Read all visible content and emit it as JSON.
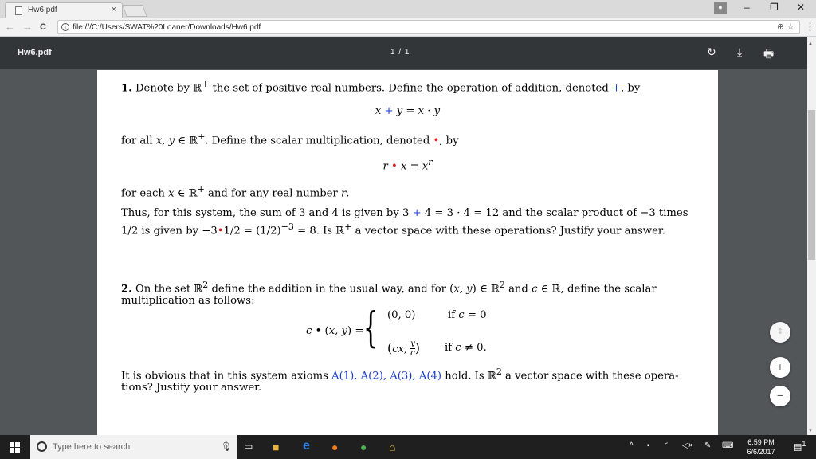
{
  "browser": {
    "tab_title": "Hw6.pdf",
    "tab_close": "×",
    "win_minimize": "–",
    "win_restore": "❐",
    "win_close": "✕",
    "url": "file:///C:/Users/SWAT%20Loaner/Downloads/Hw6.pdf",
    "back": "←",
    "forward": "→",
    "reload": "C",
    "zoom_icon": "⊕",
    "star_icon": "☆",
    "menu": "⋮"
  },
  "pdf_viewer": {
    "title": "Hw6.pdf",
    "page_indicator": "1 / 1",
    "rotate_icon": "↻",
    "download_icon": "⤓",
    "print_icon": "🖶"
  },
  "problem1": {
    "line1_a": "1.",
    "line1_b": " Denote by ℝ",
    "line1_sup": "+",
    "line1_c": " the set of positive real numbers. Define the operation of addition, denoted ",
    "plus": "+",
    "line1_d": ", by",
    "eq1_a": "x ",
    "eq1_b": " y = x · y",
    "line2_a": "for all ",
    "line2_b": "x, y",
    "line2_c": " ∈ ℝ",
    "line2_sup": "+",
    "line2_d": ". Define the scalar multiplication, denoted ",
    "dot": "•",
    "line2_e": ", by",
    "eq2_a": "r ",
    "eq2_b": " x = x",
    "eq2_sup": "r",
    "line3_a": "for each ",
    "line3_b": "x",
    "line3_c": " ∈ ℝ",
    "line3_sup": "+",
    "line3_d": " and for any real number ",
    "line3_e": "r",
    "line3_f": ".",
    "line4_a": "Thus, for this system, the sum of 3 and 4 is given by 3 ",
    "line4_b": " 4 = 3 · 4 = 12 and the scalar product of −3 times",
    "line5_a": "1/2 is given by −3",
    "line5_b": "1/2 = (1/2)",
    "line5_sup": "−3",
    "line5_c": " = 8. Is ℝ",
    "line5_sup2": "+",
    "line5_d": " a vector space with these operations? Justify your answer."
  },
  "problem2": {
    "line1_a": "2.",
    "line1_b": " On the set ℝ",
    "line1_sup": "2",
    "line1_c": " define the addition in the usual way, and for (",
    "line1_d": "x, y",
    "line1_e": ") ∈ ℝ",
    "line1_sup2": "2",
    "line1_f": " and ",
    "line1_g": "c",
    "line1_h": " ∈ ℝ, define the scalar",
    "line2": "multiplication as follows:",
    "lhs_a": "c ",
    "lhs_b": "• (",
    "lhs_c": "x, y",
    "lhs_d": ") =",
    "brace": "{",
    "case1_val": "(0, 0)",
    "case1_cond_a": "if ",
    "case1_cond_b": "c",
    "case1_cond_c": " = 0",
    "case2_val_a": "(",
    "case2_val_b": "cx, ",
    "case2_num": "y",
    "case2_den": "c",
    "case2_val_c": ")",
    "case2_cond_a": "if ",
    "case2_cond_b": "c",
    "case2_cond_c": " ≠ 0.",
    "line3_a": "It is obvious that in this system axioms ",
    "axioms": "A(1), A(2), A(3), A(4)",
    "line3_b": " hold. Is ℝ",
    "line3_sup": "2",
    "line3_c": " a vector space with these opera-",
    "line4": "tions? Justify your answer."
  },
  "zoom_controls": {
    "fit": "⇕",
    "plus": "+",
    "minus": "−"
  },
  "taskbar": {
    "search_placeholder": "Type here to search",
    "mic_icon": "🎙",
    "time": "6:59 PM",
    "date": "6/6/2017",
    "notification_count": "1",
    "tray_up": "^",
    "tray_wifi": "◜",
    "tray_volume": "◁×",
    "tray_pen": "✎",
    "tray_keyboard": "⌨"
  },
  "colors": {
    "blue": "#1a3dd1",
    "red": "#e21b1b",
    "toolbar": "#323639",
    "viewer_bg": "#525659"
  }
}
